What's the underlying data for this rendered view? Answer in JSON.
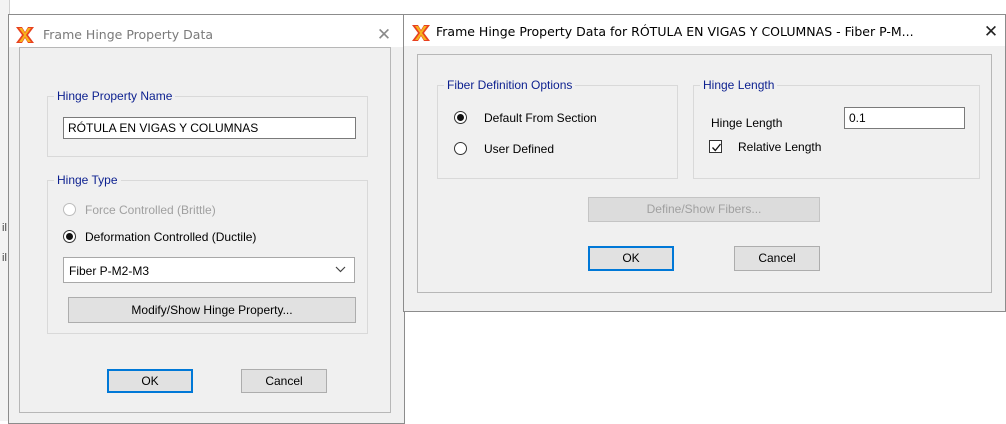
{
  "dialog1": {
    "title": "Frame Hinge Property Data",
    "close_glyph": "✕",
    "hinge_name_group": {
      "label": "Hinge Property Name",
      "value": "RÓTULA EN VIGAS Y COLUMNAS"
    },
    "hinge_type_group": {
      "label": "Hinge Type",
      "force_controlled": "Force Controlled  (Brittle)",
      "deformation_controlled": "Deformation Controlled  (Ductile)",
      "selected": "Deformation Controlled  (Ductile)",
      "dropdown_value": "Fiber P-M2-M3",
      "modify_button": "Modify/Show Hinge Property..."
    },
    "ok_label": "OK",
    "cancel_label": "Cancel"
  },
  "dialog2": {
    "title": "Frame Hinge Property Data for RÓTULA EN VIGAS Y COLUMNAS - Fiber P-M...",
    "close_glyph": "✕",
    "fiber_options": {
      "label": "Fiber Definition Options",
      "default_from_section": "Default From Section",
      "user_defined": "User Defined",
      "selected": "Default From Section"
    },
    "hinge_length": {
      "label": "Hinge Length",
      "field_label": "Hinge Length",
      "value": "0.1",
      "relative_label": "Relative Length",
      "relative_checked": true
    },
    "define_fibers_button": "Define/Show Fibers...",
    "ok_label": "OK",
    "cancel_label": "Cancel"
  },
  "colors": {
    "group_label": "#0b1f8f",
    "default_button_border": "#0078d7",
    "dialog_face": "#f0f0f0"
  },
  "icons": {
    "app_icon": "sap2000-x-icon",
    "close": "close-icon",
    "dropdown": "chevron-down-icon",
    "check": "checkmark-icon"
  }
}
